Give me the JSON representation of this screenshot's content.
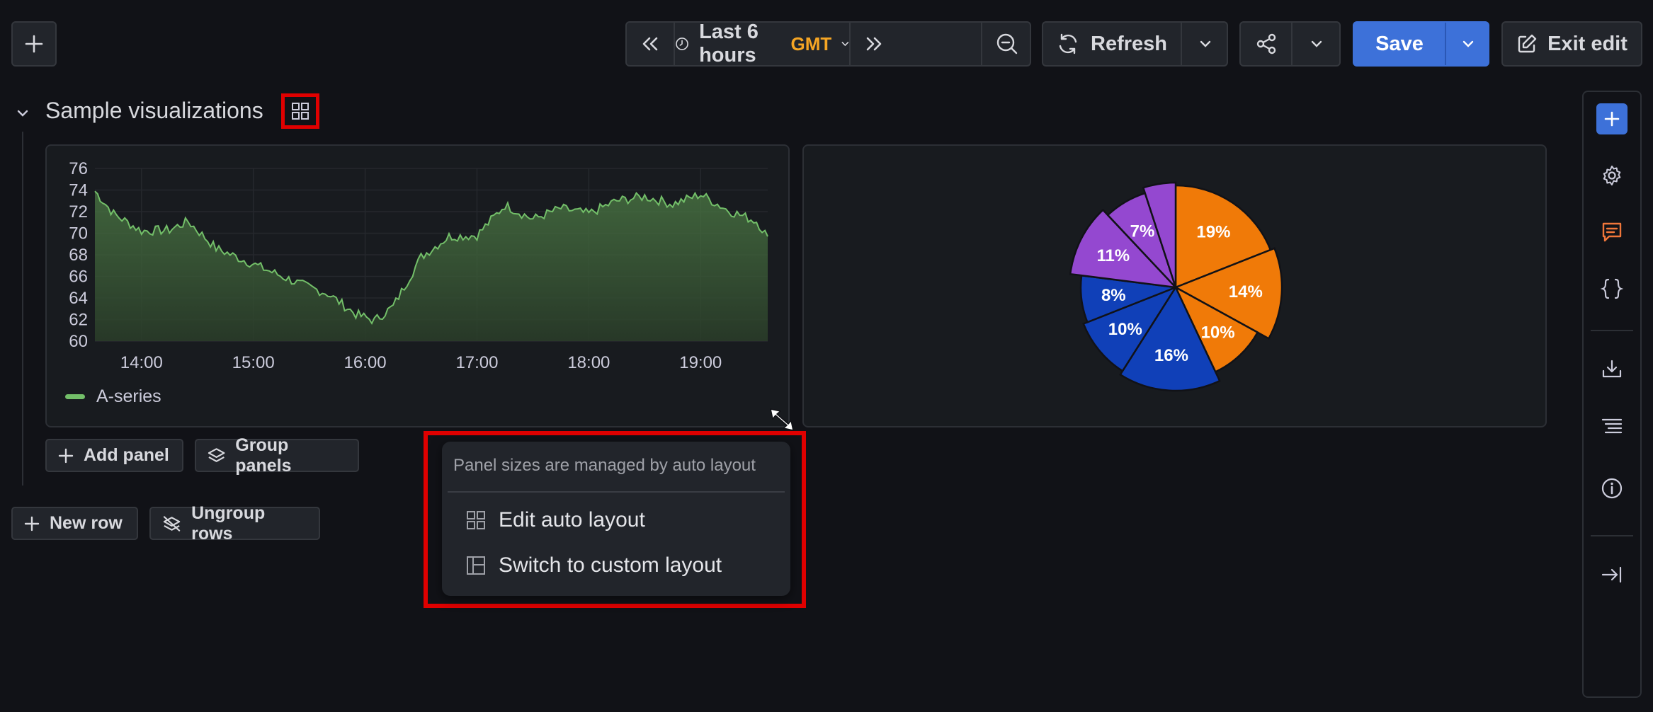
{
  "toolbar": {
    "time_range_label": "Last 6 hours",
    "timezone": "GMT",
    "refresh_label": "Refresh",
    "save_label": "Save",
    "exit_edit_label": "Exit edit"
  },
  "row": {
    "title": "Sample visualizations"
  },
  "timeseries_panel": {
    "legend": "A-series"
  },
  "chart_data": [
    {
      "type": "area",
      "ylim": [
        60,
        76
      ],
      "yticks": [
        "76",
        "74",
        "72",
        "70",
        "68",
        "66",
        "64",
        "62",
        "60"
      ],
      "xticks": [
        "14:00",
        "15:00",
        "16:00",
        "17:00",
        "18:00",
        "19:00"
      ],
      "series": [
        {
          "name": "A-series",
          "color": "#73bf69",
          "x": [
            "13:35",
            "13:45",
            "14:00",
            "14:15",
            "14:25",
            "14:40",
            "14:55",
            "15:10",
            "15:25",
            "15:40",
            "15:55",
            "16:05",
            "16:15",
            "16:30",
            "16:45",
            "17:00",
            "17:15",
            "17:30",
            "17:45",
            "18:00",
            "18:15",
            "18:30",
            "18:45",
            "19:00",
            "19:15",
            "19:30",
            "19:36"
          ],
          "y": [
            73.9,
            71.8,
            70.2,
            70.3,
            71.1,
            68.6,
            67.5,
            66.4,
            65.3,
            64.4,
            62.5,
            61.9,
            63.2,
            67.8,
            69.7,
            69.8,
            72.6,
            71.3,
            72.3,
            71.8,
            73.0,
            73.4,
            72.7,
            73.6,
            72.1,
            71.1,
            69.7
          ]
        }
      ]
    },
    {
      "type": "pie",
      "slices": [
        {
          "label": "19%",
          "value": 19,
          "color": "#f07a08"
        },
        {
          "label": "14%",
          "value": 14,
          "color": "#f07a08"
        },
        {
          "label": "10%",
          "value": 10,
          "color": "#f07a08"
        },
        {
          "label": "16%",
          "value": 16,
          "color": "#1040b8"
        },
        {
          "label": "10%",
          "value": 10,
          "color": "#1040b8"
        },
        {
          "label": "8%",
          "value": 8,
          "color": "#1040b8"
        },
        {
          "label": "11%",
          "value": 11,
          "color": "#9448d0"
        },
        {
          "label": "7%",
          "value": 7,
          "color": "#9448d0"
        },
        {
          "label": "",
          "value": 5,
          "color": "#9448d0"
        }
      ]
    }
  ],
  "row_actions": {
    "add_panel": "Add panel",
    "group_panels": "Group panels"
  },
  "dashboard_actions": {
    "new_row": "New row",
    "ungroup_rows": "Ungroup rows"
  },
  "layout_menu": {
    "header": "Panel sizes are managed by auto layout",
    "items": [
      "Edit auto layout",
      "Switch to custom layout"
    ]
  },
  "colors": {
    "background": "#111217",
    "primary": "#3d71d9",
    "highlight": "#e00000",
    "accent_orange": "#f5a524"
  }
}
